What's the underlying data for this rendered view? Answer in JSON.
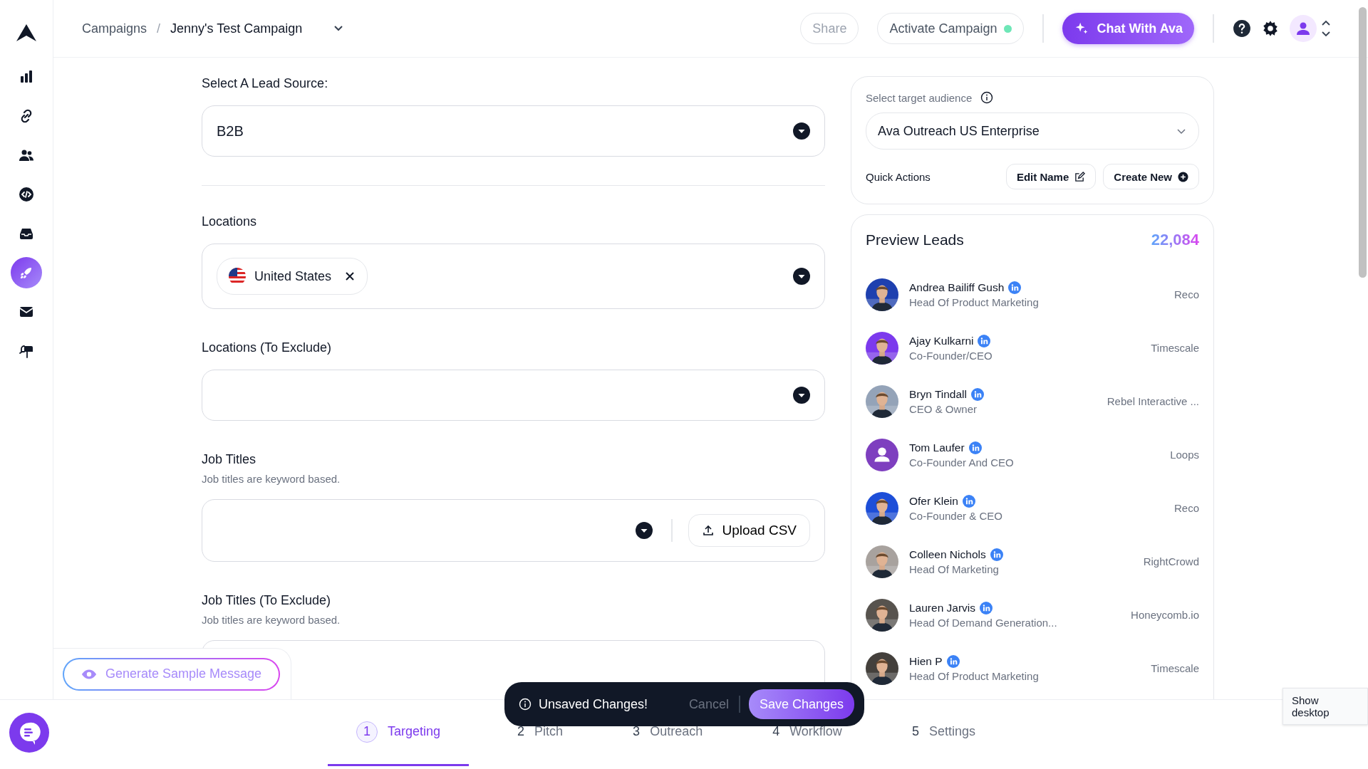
{
  "sidebar": {
    "items": [
      {
        "kind": "chart",
        "selected": false
      },
      {
        "kind": "link",
        "selected": false
      },
      {
        "kind": "users",
        "selected": false
      },
      {
        "kind": "code",
        "selected": false
      },
      {
        "kind": "inbox",
        "selected": false
      },
      {
        "kind": "rocket",
        "selected": true
      },
      {
        "kind": "mail",
        "selected": false
      },
      {
        "kind": "mailbox",
        "selected": false
      }
    ]
  },
  "breadcrumb": {
    "items": [
      "Campaigns",
      "Jenny's Test Campaign"
    ],
    "separator": "/"
  },
  "header": {
    "share": "Share",
    "activate": "Activate Campaign",
    "chat": "Chat With Ava"
  },
  "form": {
    "lead_source": {
      "label": "Select A Lead Source:",
      "value": "B2B"
    },
    "locations": {
      "label": "Locations",
      "tags": [
        "United States"
      ]
    },
    "locations_exclude": {
      "label": "Locations (To Exclude)"
    },
    "job_titles": {
      "label": "Job Titles",
      "hint": "Job titles are keyword based.",
      "upload": "Upload CSV"
    },
    "job_titles_exclude": {
      "label": "Job Titles (To Exclude)",
      "hint": "Job titles are keyword based."
    }
  },
  "audience": {
    "label": "Select target audience",
    "value": "Ava Outreach US Enterprise",
    "quick_actions": "Quick Actions",
    "edit": "Edit Name",
    "create": "Create New"
  },
  "preview": {
    "title": "Preview Leads",
    "count": "22,084",
    "leads": [
      {
        "name": "Andrea Bailiff Gush",
        "title": "Head Of Product Marketing",
        "company": "Reco"
      },
      {
        "name": "Ajay Kulkarni",
        "title": "Co-Founder/CEO",
        "company": "Timescale"
      },
      {
        "name": "Bryn Tindall",
        "title": "CEO & Owner",
        "company": "Rebel Interactive ..."
      },
      {
        "name": "Tom Laufer",
        "title": "Co-Founder And CEO",
        "company": "Loops",
        "kind": "placeholder"
      },
      {
        "name": "Ofer Klein",
        "title": "Co-Founder & CEO",
        "company": "Reco"
      },
      {
        "name": "Colleen Nichols",
        "title": "Head Of Marketing",
        "company": "RightCrowd"
      },
      {
        "name": "Lauren Jarvis",
        "title": "Head Of Demand Generation...",
        "company": "Honeycomb.io"
      },
      {
        "name": "Hien P",
        "title": "Head Of Product Marketing",
        "company": "Timescale"
      }
    ]
  },
  "generate_button": "Generate Sample Message",
  "toast": {
    "message": "Unsaved Changes!",
    "cancel": "Cancel",
    "save": "Save Changes"
  },
  "steps": [
    {
      "number": "1",
      "label": "Targeting",
      "selected": true
    },
    {
      "number": "2",
      "label": "Pitch",
      "selected": false
    },
    {
      "number": "3",
      "label": "Outreach",
      "selected": false
    },
    {
      "number": "4",
      "label": "Workflow",
      "selected": false
    },
    {
      "number": "5",
      "label": "Settings",
      "selected": false
    }
  ],
  "tooltip": "Show desktop"
}
